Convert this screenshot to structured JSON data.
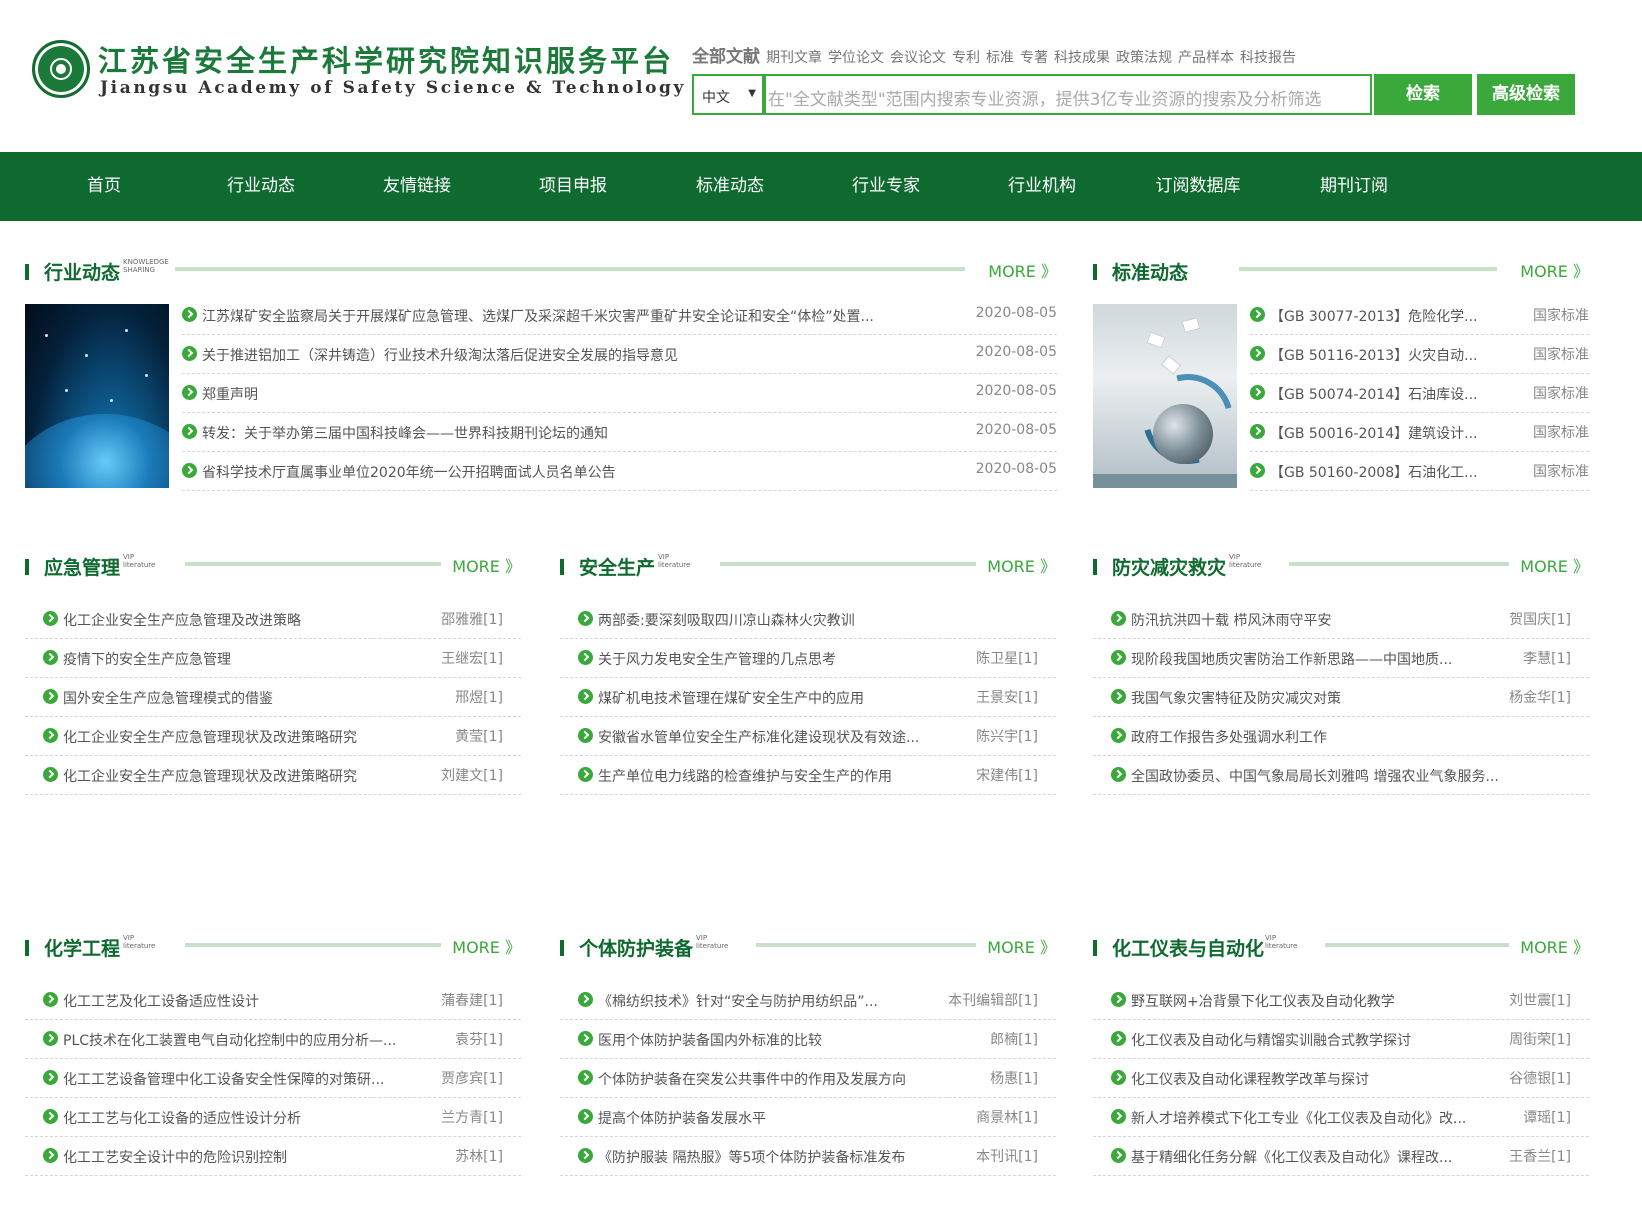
{
  "header": {
    "logo_cn": "江苏省安全生产科学研究院知识服务平台",
    "logo_en": "Jiangsu Academy of Safety Science & Technology",
    "search_types_active": "全部文献",
    "search_types": [
      "期刊文章",
      "学位论文",
      "会议论文",
      "专利",
      "标准",
      "专著",
      "科技成果",
      "政策法规",
      "产品样本",
      "科技报告"
    ],
    "lang": "中文",
    "search_placeholder": "在\"全文献类型\"范围内搜索专业资源，提供3亿专业资源的搜索及分析筛选",
    "search_button": "检索",
    "advanced_button": "高级检索"
  },
  "nav": [
    "首页",
    "行业动态",
    "友情链接",
    "项目申报",
    "标准动态",
    "行业专家",
    "行业机构",
    "订阅数据库",
    "期刊订阅"
  ],
  "more": "MORE 》",
  "industry": {
    "title": "行业动态",
    "tag": "KNOWLEDGE SHARING",
    "items": [
      {
        "title": "江苏煤矿安全监察局关于开展煤矿应急管理、选煤厂及采深超千米灾害严重矿井安全论证和安全“体检”处置...",
        "meta": "2020-08-05"
      },
      {
        "title": "关于推进铝加工（深井铸造）行业技术升级淘汰落后促进安全发展的指导意见",
        "meta": "2020-08-05"
      },
      {
        "title": "郑重声明",
        "meta": "2020-08-05"
      },
      {
        "title": "转发：关于举办第三届中国科技峰会——世界科技期刊论坛的通知",
        "meta": "2020-08-05"
      },
      {
        "title": "省科学技术厅直属事业单位2020年统一公开招聘面试人员名单公告",
        "meta": "2020-08-05"
      }
    ]
  },
  "standards": {
    "title": "标准动态",
    "items": [
      {
        "title": "【GB 30077-2013】危险化学...",
        "meta": "国家标准"
      },
      {
        "title": "【GB 50116-2013】火灾自动...",
        "meta": "国家标准"
      },
      {
        "title": "【GB 50074-2014】石油库设...",
        "meta": "国家标准"
      },
      {
        "title": "【GB 50016-2014】建筑设计...",
        "meta": "国家标准"
      },
      {
        "title": "【GB 50160-2008】石油化工...",
        "meta": "国家标准"
      }
    ]
  },
  "emergency": {
    "title": "应急管理",
    "tag": "VIP literature",
    "items": [
      {
        "title": "化工企业安全生产应急管理及改进策略",
        "meta": "邵雅雅[1]"
      },
      {
        "title": "疫情下的安全生产应急管理",
        "meta": "王继宏[1]"
      },
      {
        "title": "国外安全生产应急管理模式的借鉴",
        "meta": "邢煜[1]"
      },
      {
        "title": "化工企业安全生产应急管理现状及改进策略研究",
        "meta": "黄莹[1]"
      },
      {
        "title": "化工企业安全生产应急管理现状及改进策略研究",
        "meta": "刘建文[1]"
      }
    ]
  },
  "safety": {
    "title": "安全生产",
    "tag": "VIP literature",
    "items": [
      {
        "title": "两部委:要深刻吸取四川凉山森林火灾教训",
        "meta": ""
      },
      {
        "title": "关于风力发电安全生产管理的几点思考",
        "meta": "陈卫星[1]"
      },
      {
        "title": "煤矿机电技术管理在煤矿安全生产中的应用",
        "meta": "王景安[1]"
      },
      {
        "title": "安徽省水管单位安全生产标准化建设现状及有效途...",
        "meta": "陈兴宇[1]"
      },
      {
        "title": "生产单位电力线路的检查维护与安全生产的作用",
        "meta": "宋建伟[1]"
      }
    ]
  },
  "disaster": {
    "title": "防灾减灾救灾",
    "tag": "VIP literature",
    "items": [
      {
        "title": "防汛抗洪四十载 栉风沐雨守平安",
        "meta": "贺国庆[1]"
      },
      {
        "title": "现阶段我国地质灾害防治工作新思路——中国地质...",
        "meta": "李慧[1]"
      },
      {
        "title": "我国气象灾害特征及防灾减灾对策",
        "meta": "杨金华[1]"
      },
      {
        "title": "政府工作报告多处强调水利工作",
        "meta": ""
      },
      {
        "title": "全国政协委员、中国气象局局长刘雅鸣 增强农业气象服务...",
        "meta": ""
      }
    ]
  },
  "chemical": {
    "title": "化学工程",
    "tag": "VIP literature",
    "items": [
      {
        "title": "化工工艺及化工设备适应性设计",
        "meta": "蒲春建[1]"
      },
      {
        "title": "PLC技术在化工装置电气自动化控制中的应用分析—...",
        "meta": "袁芬[1]"
      },
      {
        "title": "化工工艺设备管理中化工设备安全性保障的对策研...",
        "meta": "贾彦宾[1]"
      },
      {
        "title": "化工工艺与化工设备的适应性设计分析",
        "meta": "兰方青[1]"
      },
      {
        "title": "化工工艺安全设计中的危险识别控制",
        "meta": "苏林[1]"
      }
    ]
  },
  "ppe": {
    "title": "个体防护装备",
    "tag": "VIP literature",
    "items": [
      {
        "title": "《棉纺织技术》针对“安全与防护用纺织品”...",
        "meta": "本刊编辑部[1]"
      },
      {
        "title": "医用个体防护装备国内外标准的比较",
        "meta": "郎楠[1]"
      },
      {
        "title": "个体防护装备在突发公共事件中的作用及发展方向",
        "meta": "杨惠[1]"
      },
      {
        "title": "提高个体防护装备发展水平",
        "meta": "商景林[1]"
      },
      {
        "title": "《防护服装 隔热服》等5项个体防护装备标准发布",
        "meta": "本刊讯[1]"
      }
    ]
  },
  "instrument": {
    "title": "化工仪表与自动化",
    "tag": "VIP literature",
    "items": [
      {
        "title": "野互联网+冶背景下化工仪表及自动化教学",
        "meta": "刘世震[1]"
      },
      {
        "title": "化工仪表及自动化与精馏实训融合式教学探讨",
        "meta": "周街荣[1]"
      },
      {
        "title": "化工仪表及自动化课程教学改革与探讨",
        "meta": "谷德银[1]"
      },
      {
        "title": "新人才培养模式下化工专业《化工仪表及自动化》改...",
        "meta": "谭瑶[1]"
      },
      {
        "title": "基于精细化任务分解《化工仪表及自动化》课程改...",
        "meta": "王香兰[1]"
      }
    ]
  }
}
